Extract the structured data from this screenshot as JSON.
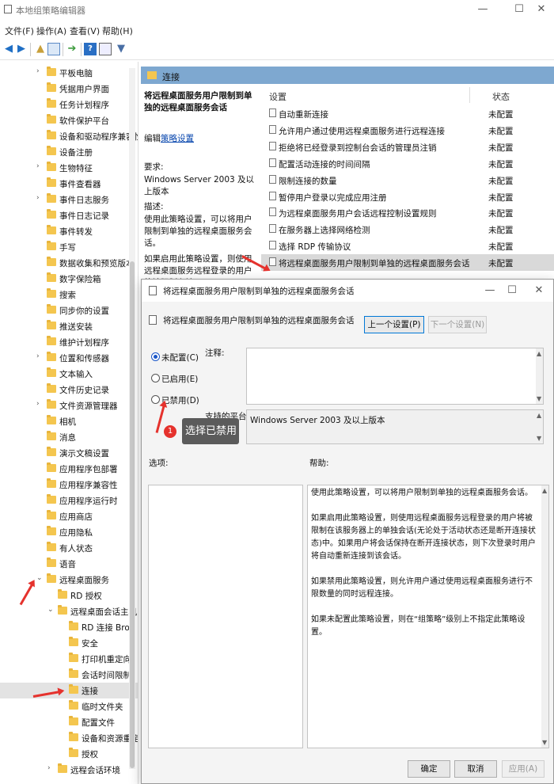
{
  "window": {
    "title": "本地组策略编辑器",
    "controls": [
      "—",
      "☐",
      "✕"
    ]
  },
  "menu": [
    "文件(F)",
    "操作(A)",
    "查看(V)",
    "帮助(H)"
  ],
  "tree": {
    "items": [
      {
        "label": "平板电脑",
        "chev": "›"
      },
      {
        "label": "凭据用户界面",
        "chev": ""
      },
      {
        "label": "任务计划程序",
        "chev": ""
      },
      {
        "label": "软件保护平台",
        "chev": ""
      },
      {
        "label": "设备和驱动程序兼容性",
        "chev": ""
      },
      {
        "label": "设备注册",
        "chev": ""
      },
      {
        "label": "生物特征",
        "chev": "›"
      },
      {
        "label": "事件查看器",
        "chev": ""
      },
      {
        "label": "事件日志服务",
        "chev": "›"
      },
      {
        "label": "事件日志记录",
        "chev": ""
      },
      {
        "label": "事件转发",
        "chev": ""
      },
      {
        "label": "手写",
        "chev": ""
      },
      {
        "label": "数据收集和预览版本",
        "chev": ""
      },
      {
        "label": "数字保险箱",
        "chev": ""
      },
      {
        "label": "搜索",
        "chev": ""
      },
      {
        "label": "同步你的设置",
        "chev": ""
      },
      {
        "label": "推送安装",
        "chev": ""
      },
      {
        "label": "维护计划程序",
        "chev": ""
      },
      {
        "label": "位置和传感器",
        "chev": "›"
      },
      {
        "label": "文本输入",
        "chev": ""
      },
      {
        "label": "文件历史记录",
        "chev": ""
      },
      {
        "label": "文件资源管理器",
        "chev": "›"
      },
      {
        "label": "相机",
        "chev": ""
      },
      {
        "label": "消息",
        "chev": ""
      },
      {
        "label": "演示文稿设置",
        "chev": ""
      },
      {
        "label": "应用程序包部署",
        "chev": ""
      },
      {
        "label": "应用程序兼容性",
        "chev": ""
      },
      {
        "label": "应用程序运行时",
        "chev": ""
      },
      {
        "label": "应用商店",
        "chev": ""
      },
      {
        "label": "应用隐私",
        "chev": ""
      },
      {
        "label": "有人状态",
        "chev": ""
      },
      {
        "label": "语音",
        "chev": ""
      },
      {
        "label": "远程桌面服务",
        "chev": "⌄"
      },
      {
        "label": "RD 授权",
        "chev": ""
      },
      {
        "label": "远程桌面会话主机",
        "chev": "⌄"
      },
      {
        "label": "RD 连接 Brok",
        "chev": ""
      },
      {
        "label": "安全",
        "chev": ""
      },
      {
        "label": "打印机重定向",
        "chev": ""
      },
      {
        "label": "会话时间限制",
        "chev": ""
      },
      {
        "label": "连接",
        "chev": ""
      },
      {
        "label": "临时文件夹",
        "chev": ""
      },
      {
        "label": "配置文件",
        "chev": ""
      },
      {
        "label": "设备和资源重定",
        "chev": ""
      },
      {
        "label": "授权",
        "chev": ""
      },
      {
        "label": "远程会话环境",
        "chev": "›"
      }
    ]
  },
  "right": {
    "header": "连接",
    "desc_title": "将远程桌面服务用户限制到单独的远程桌面服务会话",
    "edit_prefix": "编辑",
    "edit_link": "策略设置",
    "req_label": "要求:",
    "req_value": "Windows Server 2003 及以上版本",
    "desc_label": "描述:",
    "desc_text": "使用此策略设置，可以将用户限制到单独的远程桌面服务会话。",
    "desc_more": "如果启用此策略设置，则使用远程桌面服务远程登录的用户将被限制在该",
    "col_setting": "设置",
    "col_state": "状态",
    "settings": [
      {
        "name": "自动重新连接",
        "state": "未配置"
      },
      {
        "name": "允许用户通过使用远程桌面服务进行远程连接",
        "state": "未配置"
      },
      {
        "name": "拒绝将已经登录到控制台会话的管理员注销",
        "state": "未配置"
      },
      {
        "name": "配置活动连接的时间间隔",
        "state": "未配置"
      },
      {
        "name": "限制连接的数量",
        "state": "未配置"
      },
      {
        "name": "暂停用户登录以完成应用注册",
        "state": "未配置"
      },
      {
        "name": "为远程桌面服务用户会话远程控制设置规则",
        "state": "未配置"
      },
      {
        "name": "在服务器上选择网络检测",
        "state": "未配置"
      },
      {
        "name": "选择 RDP 传输协议",
        "state": "未配置"
      },
      {
        "name": "将远程桌面服务用户限制到单独的远程桌面服务会话",
        "state": "未配置"
      }
    ]
  },
  "dialog": {
    "title": "将远程桌面服务用户限制到单独的远程桌面服务会话",
    "policy_name": "将远程桌面服务用户限制到单独的远程桌面服务会话",
    "prev_button": "上一个设置(P)",
    "next_button": "下一个设置(N)",
    "radio_notconfigured": "未配置(C)",
    "radio_enabled": "已启用(E)",
    "radio_disabled": "已禁用(D)",
    "comment_label": "注释:",
    "platform_label": "支持的平台:",
    "platform_value": "Windows Server 2003 及以上版本",
    "options_label": "选项:",
    "help_label": "帮助:",
    "help_p1": "使用此策略设置，可以将用户限制到单独的远程桌面服务会话。",
    "help_p2": "如果启用此策略设置，则使用远程桌面服务远程登录的用户将被限制在该服务器上的单独会话(无论处于活动状态还是断开连接状态)中。如果用户将会话保持在断开连接状态，则下次登录时用户将自动重新连接到该会话。",
    "help_p3": "如果禁用此策略设置，则允许用户通过使用远程桌面服务进行不限数量的同时远程连接。",
    "help_p4": "如果未配置此策略设置，则在“组策略”级别上不指定此策略设置。",
    "ok_button": "确定",
    "cancel_button": "取消",
    "apply_button": "应用(A)"
  },
  "annotation": {
    "number": "1",
    "text": "选择已禁用",
    "color": "#e5322d"
  }
}
